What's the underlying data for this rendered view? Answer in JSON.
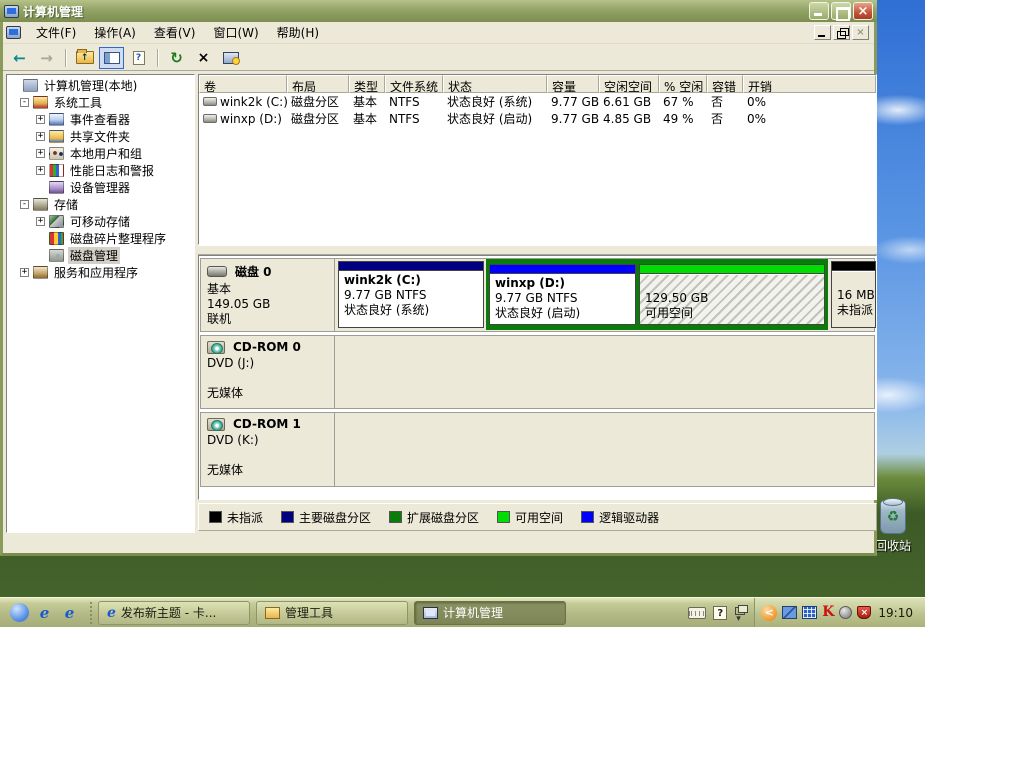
{
  "window": {
    "title": "计算机管理",
    "menus": [
      "文件(F)",
      "操作(A)",
      "查看(V)",
      "窗口(W)",
      "帮助(H)"
    ]
  },
  "icons": {
    "back_arrow": "←",
    "forward_arrow": "→",
    "up_arrow": "↑",
    "refresh": "↻",
    "delete_x": "×",
    "close_x": "×",
    "mdi_close_x": "×",
    "question": "?",
    "plus": "+",
    "minus": "-",
    "ie_e": "e",
    "recycle": "♻",
    "chevron_left": "<",
    "lang_down_arrow": "▾",
    "shield_x": "×"
  },
  "tree": {
    "items": [
      {
        "label": "计算机管理(本地)",
        "expander": "",
        "level": 0
      },
      {
        "label": "系统工具",
        "expander": "-",
        "level": 1
      },
      {
        "label": "事件查看器",
        "expander": "+",
        "level": 2
      },
      {
        "label": "共享文件夹",
        "expander": "+",
        "level": 2
      },
      {
        "label": "本地用户和组",
        "expander": "+",
        "level": 2
      },
      {
        "label": "性能日志和警报",
        "expander": "+",
        "level": 2
      },
      {
        "label": "设备管理器",
        "expander": "",
        "level": 2
      },
      {
        "label": "存储",
        "expander": "-",
        "level": 1
      },
      {
        "label": "可移动存储",
        "expander": "+",
        "level": 2
      },
      {
        "label": "磁盘碎片整理程序",
        "expander": "",
        "level": 2
      },
      {
        "label": "磁盘管理",
        "expander": "",
        "level": 2,
        "selected": true
      },
      {
        "label": "服务和应用程序",
        "expander": "+",
        "level": 1
      }
    ]
  },
  "volumes": {
    "headers": [
      "卷",
      "布局",
      "类型",
      "文件系统",
      "状态",
      "容量",
      "空闲空间",
      "% 空闲",
      "容错",
      "开销"
    ],
    "rows": [
      {
        "cells": [
          "wink2k (C:)",
          "磁盘分区",
          "基本",
          "NTFS",
          "状态良好 (系统)",
          "9.77 GB",
          "6.61 GB",
          "67 %",
          "否",
          "0%"
        ]
      },
      {
        "cells": [
          "winxp (D:)",
          "磁盘分区",
          "基本",
          "NTFS",
          "状态良好 (启动)",
          "9.77 GB",
          "4.85 GB",
          "49 %",
          "否",
          "0%"
        ]
      }
    ]
  },
  "disk0": {
    "name": "磁盘 0",
    "type": "基本",
    "size": "149.05 GB",
    "status": "联机",
    "partitions": [
      {
        "name": "wink2k (C:)",
        "size": "9.77 GB NTFS",
        "status": "状态良好 (系统)",
        "color": "#000080"
      },
      {
        "name": "winxp (D:)",
        "size": "9.77 GB NTFS",
        "status": "状态良好 (启动)",
        "color": "#0000ff"
      },
      {
        "size": "129.50 GB",
        "status": "可用空间",
        "color": "#00dd00"
      },
      {
        "size": "16 MB",
        "status": "未指派",
        "color": "#000000"
      }
    ]
  },
  "cdroms": [
    {
      "name": "CD-ROM 0",
      "drive": "DVD (J:)",
      "media": "无媒体"
    },
    {
      "name": "CD-ROM 1",
      "drive": "DVD (K:)",
      "media": "无媒体"
    }
  ],
  "legend": {
    "items": [
      {
        "label": "未指派",
        "color": "#000000"
      },
      {
        "label": "主要磁盘分区",
        "color": "#000080"
      },
      {
        "label": "扩展磁盘分区",
        "color": "#0a7c0a"
      },
      {
        "label": "可用空间",
        "color": "#00dd00"
      },
      {
        "label": "逻辑驱动器",
        "color": "#0000ff"
      }
    ]
  },
  "taskbar": {
    "tasks": [
      {
        "label": "发布新主题 - 卡..."
      },
      {
        "label": "管理工具"
      },
      {
        "label": "计算机管理",
        "active": true
      }
    ],
    "clock": "19:10"
  },
  "desktop": {
    "recycle_bin_label": "回收站"
  }
}
